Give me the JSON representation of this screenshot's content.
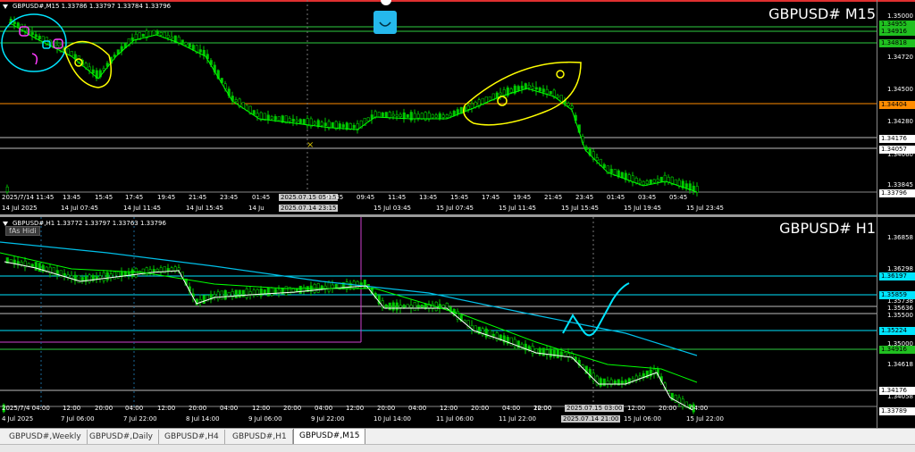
{
  "top_chart": {
    "info": "GBPUSD#,M15  1.33786 1.33797 1.33784 1.33796",
    "title": "GBPUSD# M15",
    "price_labels": [
      "1.35000",
      "1.34955",
      "1.34916",
      "1.34818",
      "1.34720",
      "1.34500",
      "1.34404",
      "1.34280",
      "1.34176",
      "1.34060",
      "1.34057",
      "1.33845",
      "1.33796"
    ],
    "tags": {
      "green1": "1.34955",
      "green2": "1.34916",
      "green3": "1.34818",
      "orange": "1.34404",
      "white1": "1.34176",
      "white2": "1.34057",
      "last": "1.33796"
    },
    "time_row1": [
      "2025/7/14 11:45",
      "13:45",
      "15:45",
      "17:45",
      "19:45",
      "21:45",
      "23:45",
      "01:45",
      "2025.07.15 05:15",
      "07:45",
      "09:45",
      "11:45",
      "13:45",
      "15:45",
      "17:45",
      "19:45",
      "21:45",
      "23:45",
      "01:45",
      "03:45",
      "05:45"
    ],
    "time_row2": [
      "14 Jul 2025",
      "14 Jul 07:45",
      "14 Jul 11:45",
      "14 Jul 15:45",
      "14 Ju",
      "2025.07.14 23:15",
      "15 Jul 03:45",
      "15 Jul 07:45",
      "15 Jul 11:45",
      "15 Jul 15:45",
      "15 Jul 19:45",
      "15 Jul 23:45"
    ]
  },
  "bottom_chart": {
    "info": "GBPUSD#,H1  1.33772 1.33797 1.33763 1.33796",
    "title": "GBPUSD# H1",
    "indicator_label": "fAs Hidi",
    "price_labels": [
      "1.36858",
      "1.36298",
      "1.36197",
      "1.35859",
      "1.35738",
      "1.35636",
      "1.35500",
      "1.35224",
      "1.35000",
      "1.34916",
      "1.34618",
      "1.34176",
      "1.34058",
      "1.33789"
    ],
    "tags": {
      "cyan1": "1.36197",
      "cyan2": "1.35859",
      "cyan3": "1.35224",
      "green": "1.34916",
      "white": "1.34176",
      "last": "1.33789"
    },
    "time_row1": [
      "2025/7/4 04:00",
      "12:00",
      "20:00",
      "04:00",
      "12:00",
      "20:00",
      "04:00",
      "12:00",
      "20:00",
      "04:00",
      "12:00",
      "20:00",
      "04:00",
      "12:00",
      "20:00",
      "04:00",
      "12:00",
      "20:00",
      "2025.07.15 03:00",
      "12:00",
      "20:00",
      "04:00"
    ],
    "time_row2": [
      "4 Jul 2025",
      "7 Jul 06:00",
      "7 Jul 22:00",
      "8 Jul 14:00",
      "9 Jul 06:00",
      "9 Jul 22:00",
      "10 Jul 14:00",
      "11 Jul 06:00",
      "11 Jul 22:00",
      "2025.07.14 21:00",
      "15 Jul 06:00",
      "15 Jul 22:00"
    ]
  },
  "tabs": [
    "GBPUSD#,Weekly",
    "GBPUSD#,Daily",
    "GBPUSD#,H4",
    "GBPUSD#,H1",
    "GBPUSD#,M15"
  ],
  "active_tab": "GBPUSD#,M15",
  "colors": {
    "candle": "#00c800",
    "ma_green": "#00ff00",
    "ma_cyan": "#00bfe8",
    "h_green": "#2ecc40",
    "h_orange": "#ff8c00",
    "h_cyan": "#00e5ff",
    "annot_yellow": "#ffff00",
    "annot_cyan": "#00e5ff",
    "annot_magenta": "#ff3cff",
    "top_border": "#e03030"
  }
}
